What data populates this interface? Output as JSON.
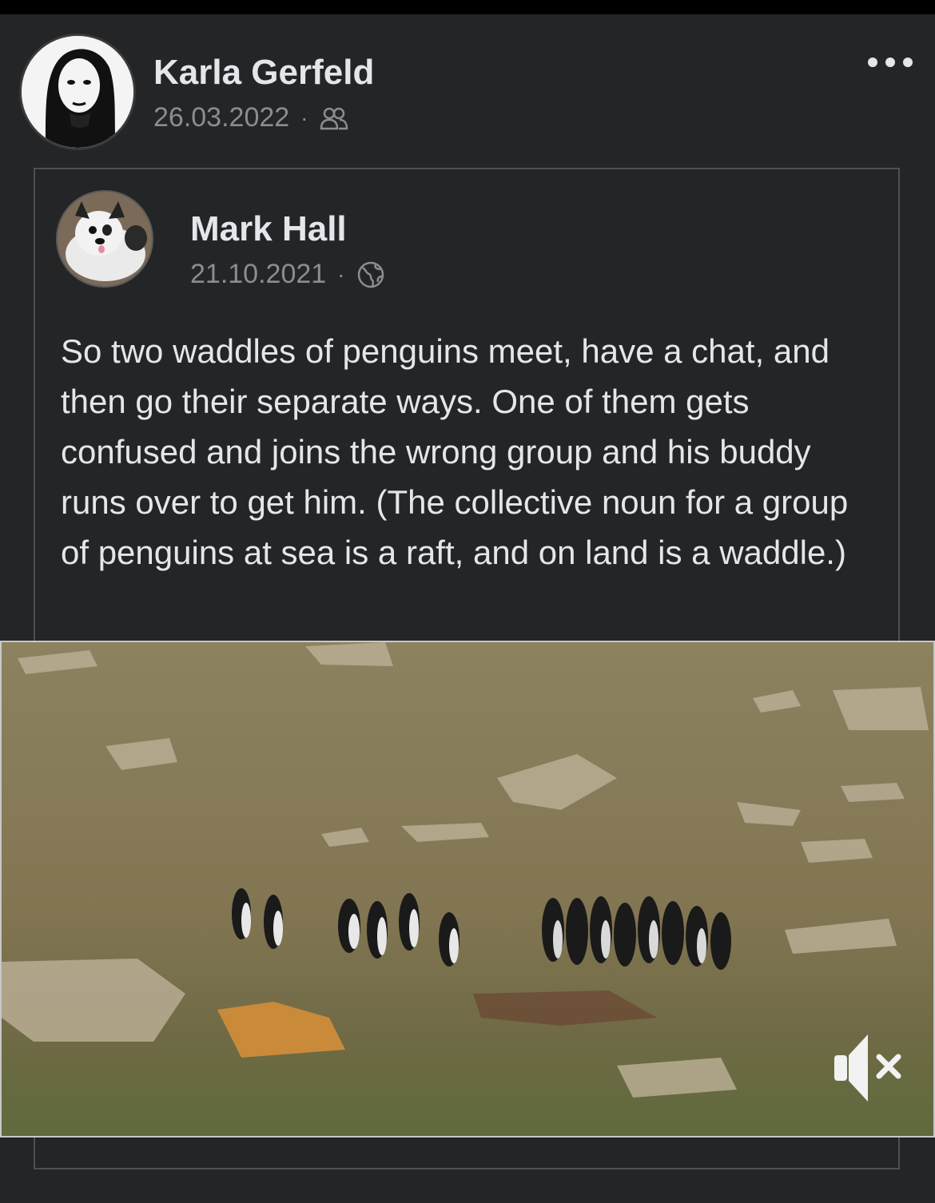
{
  "post": {
    "author": "Karla Gerfeld",
    "date": "26.03.2022",
    "audience_icon": "friends-icon",
    "more_icon": "more-options-icon"
  },
  "shared_post": {
    "author": "Mark Hall",
    "date": "21.10.2021",
    "audience_icon": "globe-icon",
    "text": "So two waddles of penguins meet, have a chat, and then go their separate ways. One of them gets confused and joins the wrong group and his buddy runs over to get him. (The collective noun for a group of penguins at sea is a raft, and on land is a waddle.)"
  },
  "video": {
    "mute_icon": "speaker-muted-icon"
  },
  "colors": {
    "background": "#242526",
    "text_primary": "#e4e6eb",
    "text_secondary": "#8a8d91",
    "border": "#4e4f50"
  }
}
